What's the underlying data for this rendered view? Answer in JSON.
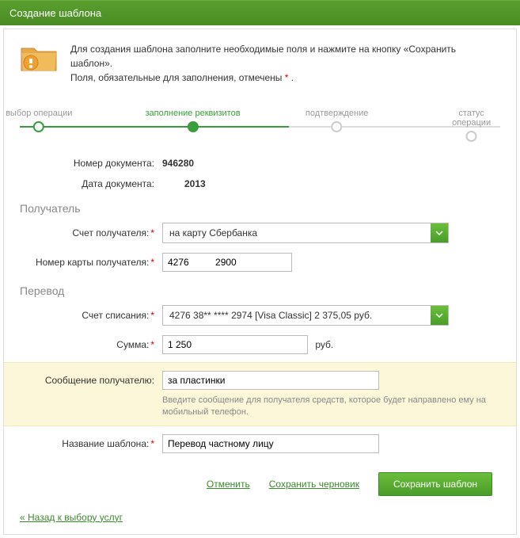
{
  "header": {
    "title": "Создание шаблона"
  },
  "intro": {
    "line1": "Для создания шаблона заполните необходимые поля и нажмите на кнопку «Сохранить шаблон».",
    "line2a": "Поля, обязательные для заполнения, отмечены ",
    "line2b": " ."
  },
  "steps": {
    "s1": "выбор операции",
    "s2": "заполнение реквизитов",
    "s3": "подтверждение",
    "s4": "статус операции"
  },
  "doc": {
    "num_label": "Номер документа:",
    "num_value": "946280",
    "date_label": "Дата документа:",
    "date_value": "2013"
  },
  "recipient": {
    "title": "Получатель",
    "account_label": "Счет получателя:",
    "account_value": "на карту Сбербанка",
    "card_label": "Номер карты получателя:",
    "card_value": "4276          2900"
  },
  "transfer": {
    "title": "Перевод",
    "debit_label": "Счет списания:",
    "debit_value": "4276 38** **** 2974  [Visa Classic] 2 375,05  руб.",
    "amount_label": "Сумма:",
    "amount_value": "1 250",
    "currency": "руб."
  },
  "message": {
    "label": "Сообщение получателю:",
    "value": "за пластинки",
    "hint": "Введите сообщение для получателя средств, которое будет направлено ему на мобильный телефон."
  },
  "template": {
    "name_label": "Название шаблона:",
    "name_value": "Перевод частному лицу"
  },
  "actions": {
    "cancel": "Отменить",
    "draft": "Сохранить черновик",
    "save": "Сохранить шаблон"
  },
  "back": {
    "label": "« Назад к выбору услуг"
  }
}
